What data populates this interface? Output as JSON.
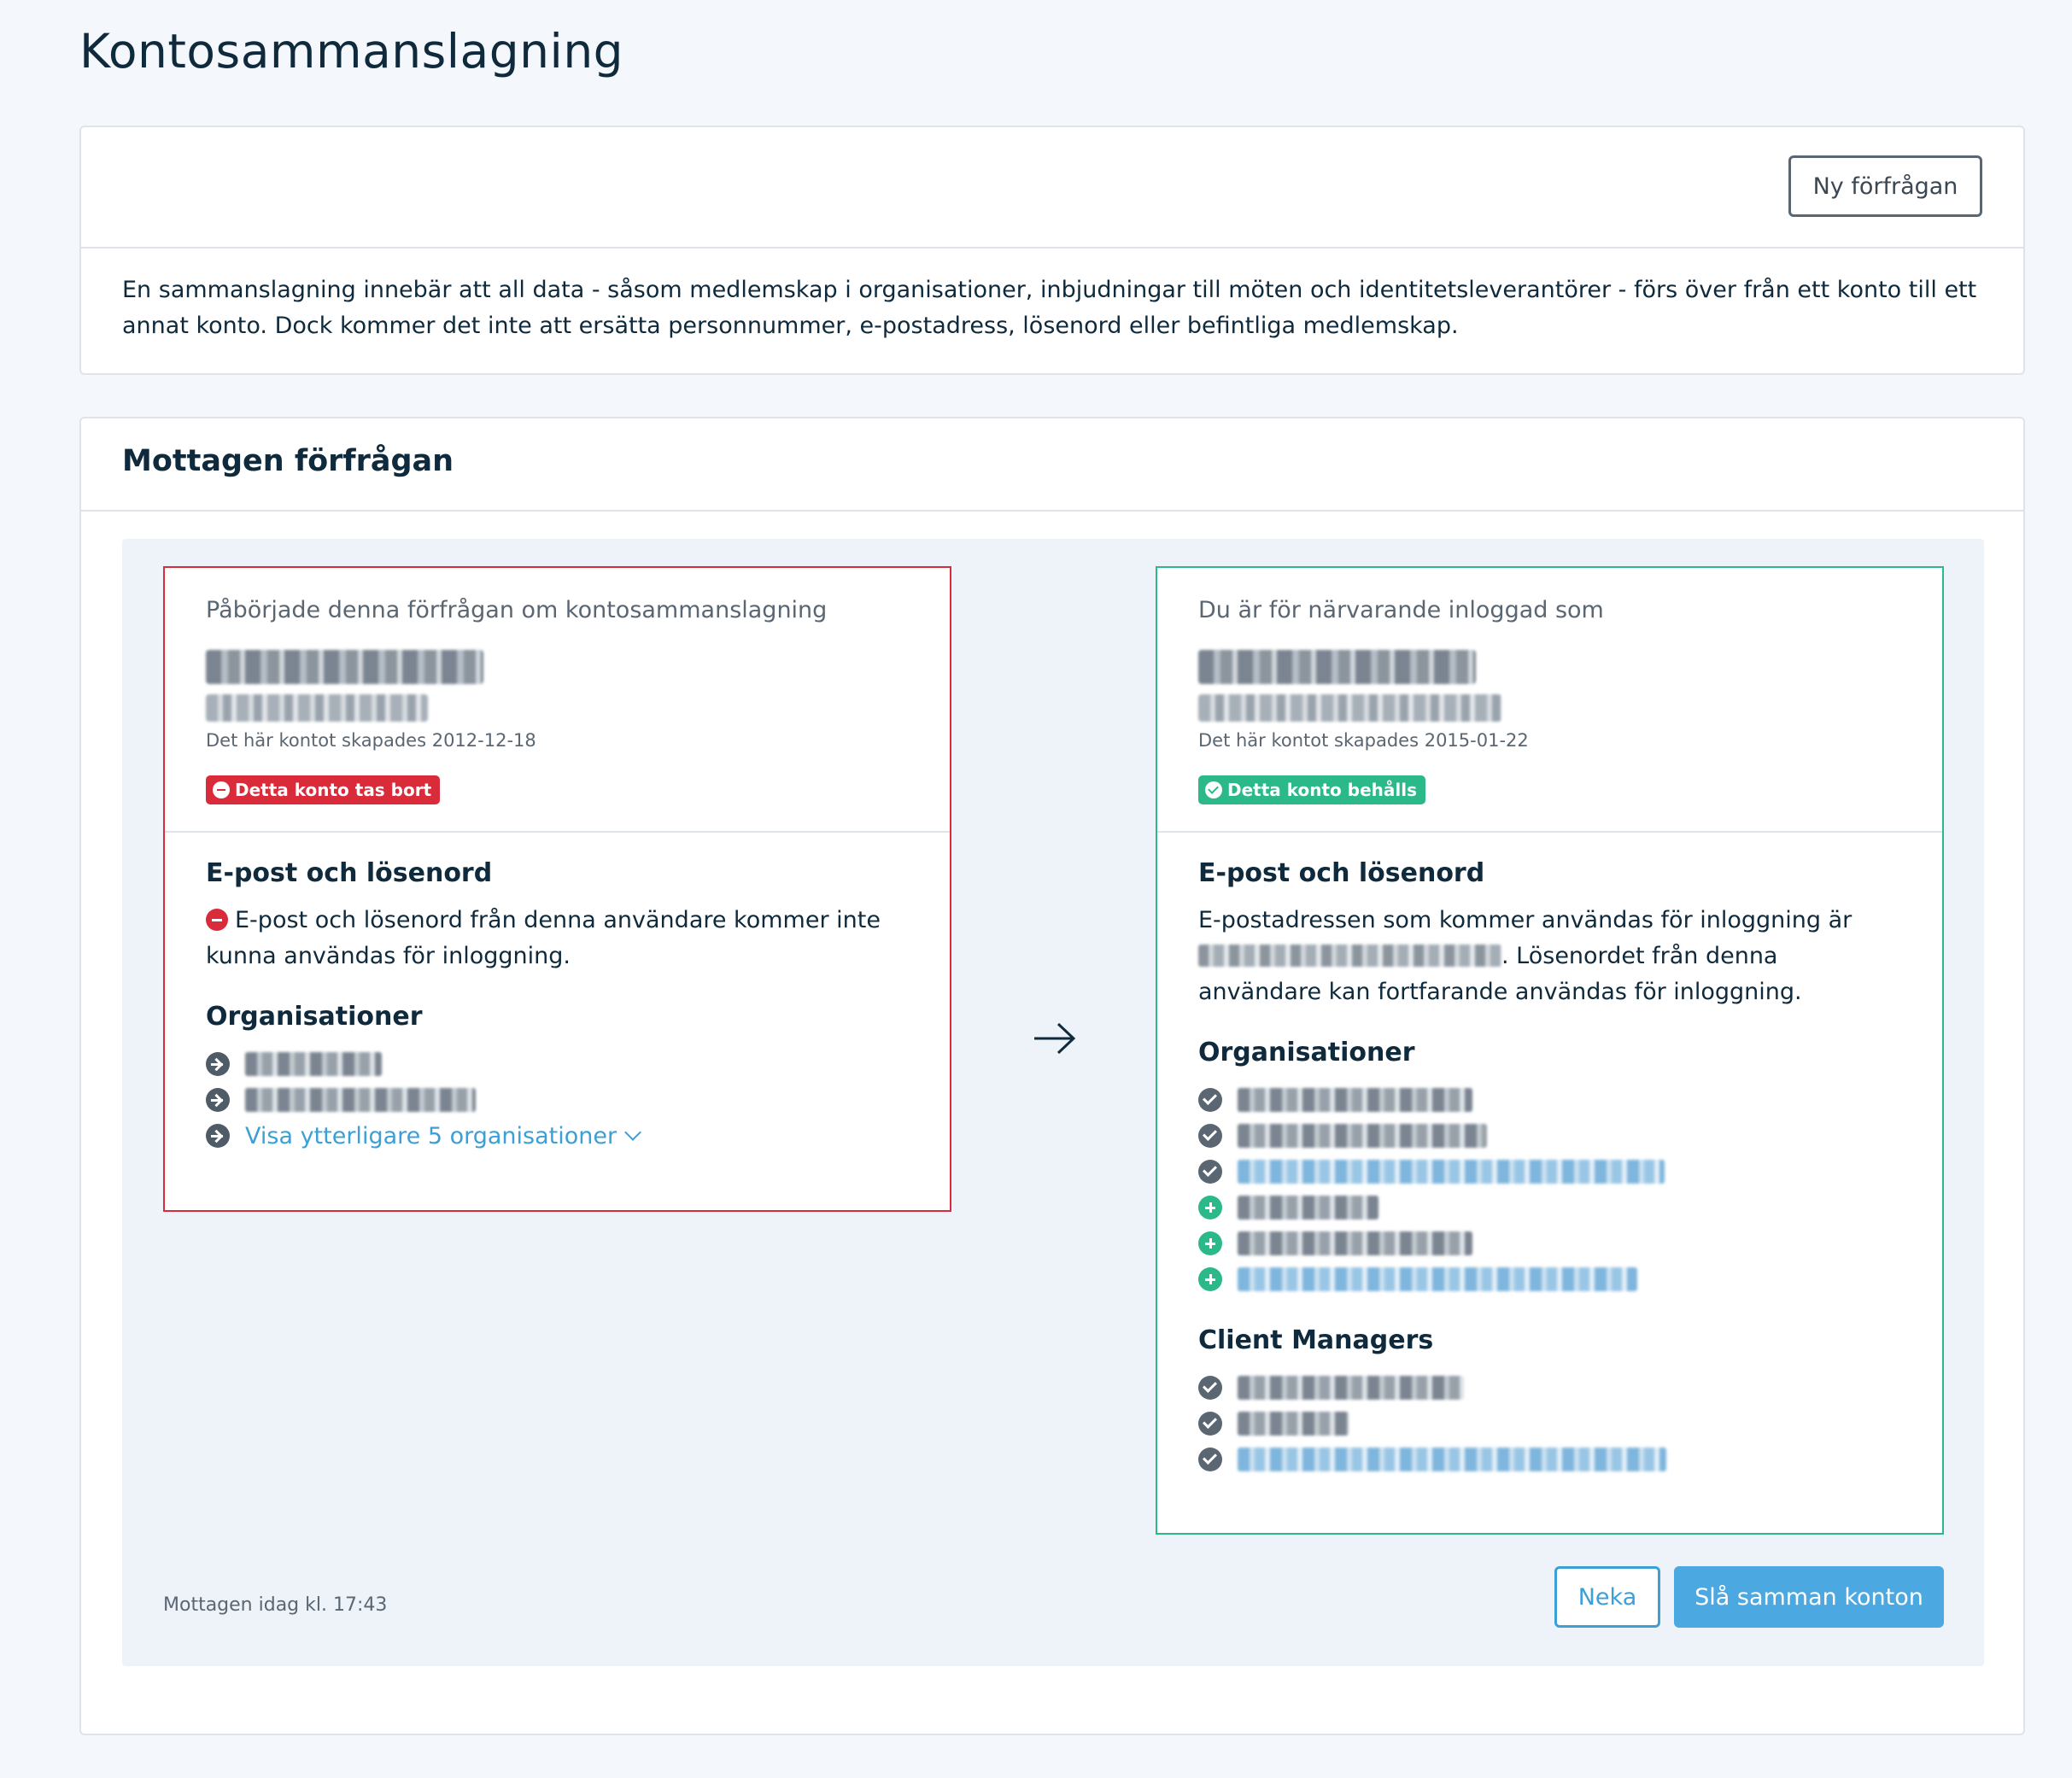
{
  "page": {
    "title": "Kontosammanslagning"
  },
  "info_card": {
    "new_request_button": "Ny förfrågan",
    "description": "En sammanslagning innebär att all data - såsom medlemskap i organisationer, inbjudningar till möten och identitetsleverantörer - förs över från ett konto till ett annat konto. Dock kommer det inte att ersätta personnummer, e-postadress, lösenord eller befintliga medlemskap."
  },
  "request": {
    "title": "Mottagen förfrågan",
    "source_account": {
      "caption": "Påbörjade denna förfrågan om kontosammanslagning",
      "created": "Det här kontot skapades 2012-12-18",
      "badge": "Detta konto tas bort",
      "email_section_title": "E-post och lösenord",
      "email_text": "E-post och lösenord från denna användare kommer inte kunna användas för inloggning.",
      "orgs_title": "Organisationer",
      "show_more": "Visa ytterligare 5 organisationer"
    },
    "target_account": {
      "caption": "Du är för närvarande inloggad som",
      "created": "Det här kontot skapades 2015-01-22",
      "badge": "Detta konto behålls",
      "email_section_title": "E-post och lösenord",
      "email_text_before": "E-postadressen som kommer användas för inloggning är",
      "email_text_after": ". Lösenordet från denna användare kan fortfarande användas för inloggning.",
      "orgs_title": "Organisationer",
      "client_managers_title": "Client Managers"
    },
    "received": "Mottagen idag kl. 17:43",
    "reject_button": "Neka",
    "merge_button": "Slå samman konton"
  },
  "colors": {
    "danger": "#d92b3a",
    "success": "#2bb98a",
    "link": "#3c9fd6",
    "primary": "#4ca8e0"
  },
  "icons": {
    "arrow": "arrow-right-icon",
    "check": "check-circle-icon",
    "plus": "plus-circle-icon",
    "minus": "minus-circle-icon"
  }
}
